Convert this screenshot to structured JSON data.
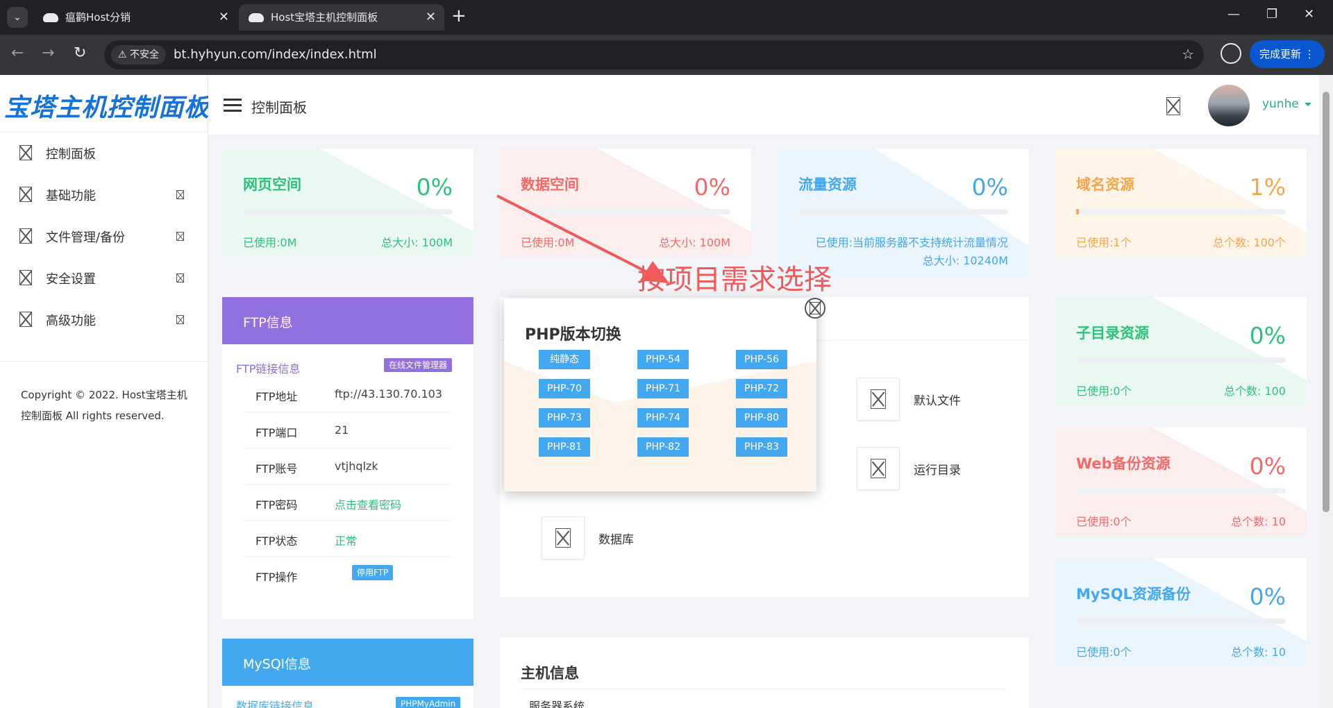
{
  "browser": {
    "tabs": [
      {
        "label": "瘟鹳Host分销"
      },
      {
        "label": "Host宝塔主机控制面板"
      }
    ],
    "insecure_label": "不安全",
    "url": "bt.hyhyun.com/index/index.html",
    "update_label": "完成更新"
  },
  "sidebar": {
    "logo": "宝塔主机控制面板",
    "items": [
      {
        "label": "控制面板"
      },
      {
        "label": "基础功能"
      },
      {
        "label": "文件管理/备份"
      },
      {
        "label": "安全设置"
      },
      {
        "label": "高级功能"
      }
    ],
    "copyright": "Copyright © 2022. Host宝塔主机控制面板 All rights reserved."
  },
  "header": {
    "title": "控制面板",
    "username": "yunhe"
  },
  "stats_top": [
    {
      "title": "网页空间",
      "percent": "0%",
      "fill": 0,
      "used": "已使用:0M",
      "total": "总大小: 100M",
      "color": "#2dc27b"
    },
    {
      "title": "数据空间",
      "percent": "0%",
      "fill": 0,
      "used": "已使用:0M",
      "total": "总大小: 100M",
      "color": "#f56868"
    },
    {
      "title": "流量资源",
      "percent": "0%",
      "fill": 0,
      "used": "已使用:当前服务器不支持统计流量情况",
      "total": "总大小: 10240M",
      "color": "#43a8ef"
    },
    {
      "title": "域名资源",
      "percent": "1%",
      "fill": 0.01,
      "used": "已使用:1个",
      "total": "总个数: 100个",
      "color": "#f7a54a"
    }
  ],
  "stats_right": [
    {
      "title": "子目录资源",
      "percent": "0%",
      "fill": 0,
      "used": "已使用:0个",
      "total": "总个数: 100",
      "color": "#2dc27b"
    },
    {
      "title": "Web备份资源",
      "percent": "0%",
      "fill": 0,
      "used": "已使用:0个",
      "total": "总个数: 10",
      "color": "#f56868"
    },
    {
      "title": "MySQL资源备份",
      "percent": "0%",
      "fill": 0,
      "used": "已使用:0个",
      "total": "总个数: 10",
      "color": "#43a8ef"
    }
  ],
  "ftp": {
    "title": "FTP信息",
    "link_info": "FTP链接信息",
    "file_manager": "在线文件管理器",
    "rows": [
      {
        "key": "FTP地址",
        "value": "ftp://43.130.70.103"
      },
      {
        "key": "FTP端口",
        "value": "21"
      },
      {
        "key": "FTP账号",
        "value": "vtjhqlzk"
      },
      {
        "key": "FTP密码",
        "value": "点击查看密码"
      },
      {
        "key": "FTP状态",
        "value": "正常"
      },
      {
        "key": "FTP操作",
        "value": ""
      }
    ],
    "stop_button": "停用FTP"
  },
  "mysql": {
    "title": "MySQl信息",
    "link_info": "数据库链接信息",
    "admin_button": "PHPMyAdmin"
  },
  "tools": [
    {
      "label": "默认文件"
    },
    {
      "label": "运行目录"
    },
    {
      "label": "数据库"
    }
  ],
  "host_info": {
    "title": "主机信息",
    "row": "服务器系统"
  },
  "annotation": "按项目需求选择",
  "php_modal": {
    "title": "PHP版本切换",
    "versions": [
      "纯静态",
      "PHP-54",
      "PHP-56",
      "PHP-70",
      "PHP-71",
      "PHP-72",
      "PHP-73",
      "PHP-74",
      "PHP-80",
      "PHP-81",
      "PHP-82",
      "PHP-83"
    ]
  }
}
